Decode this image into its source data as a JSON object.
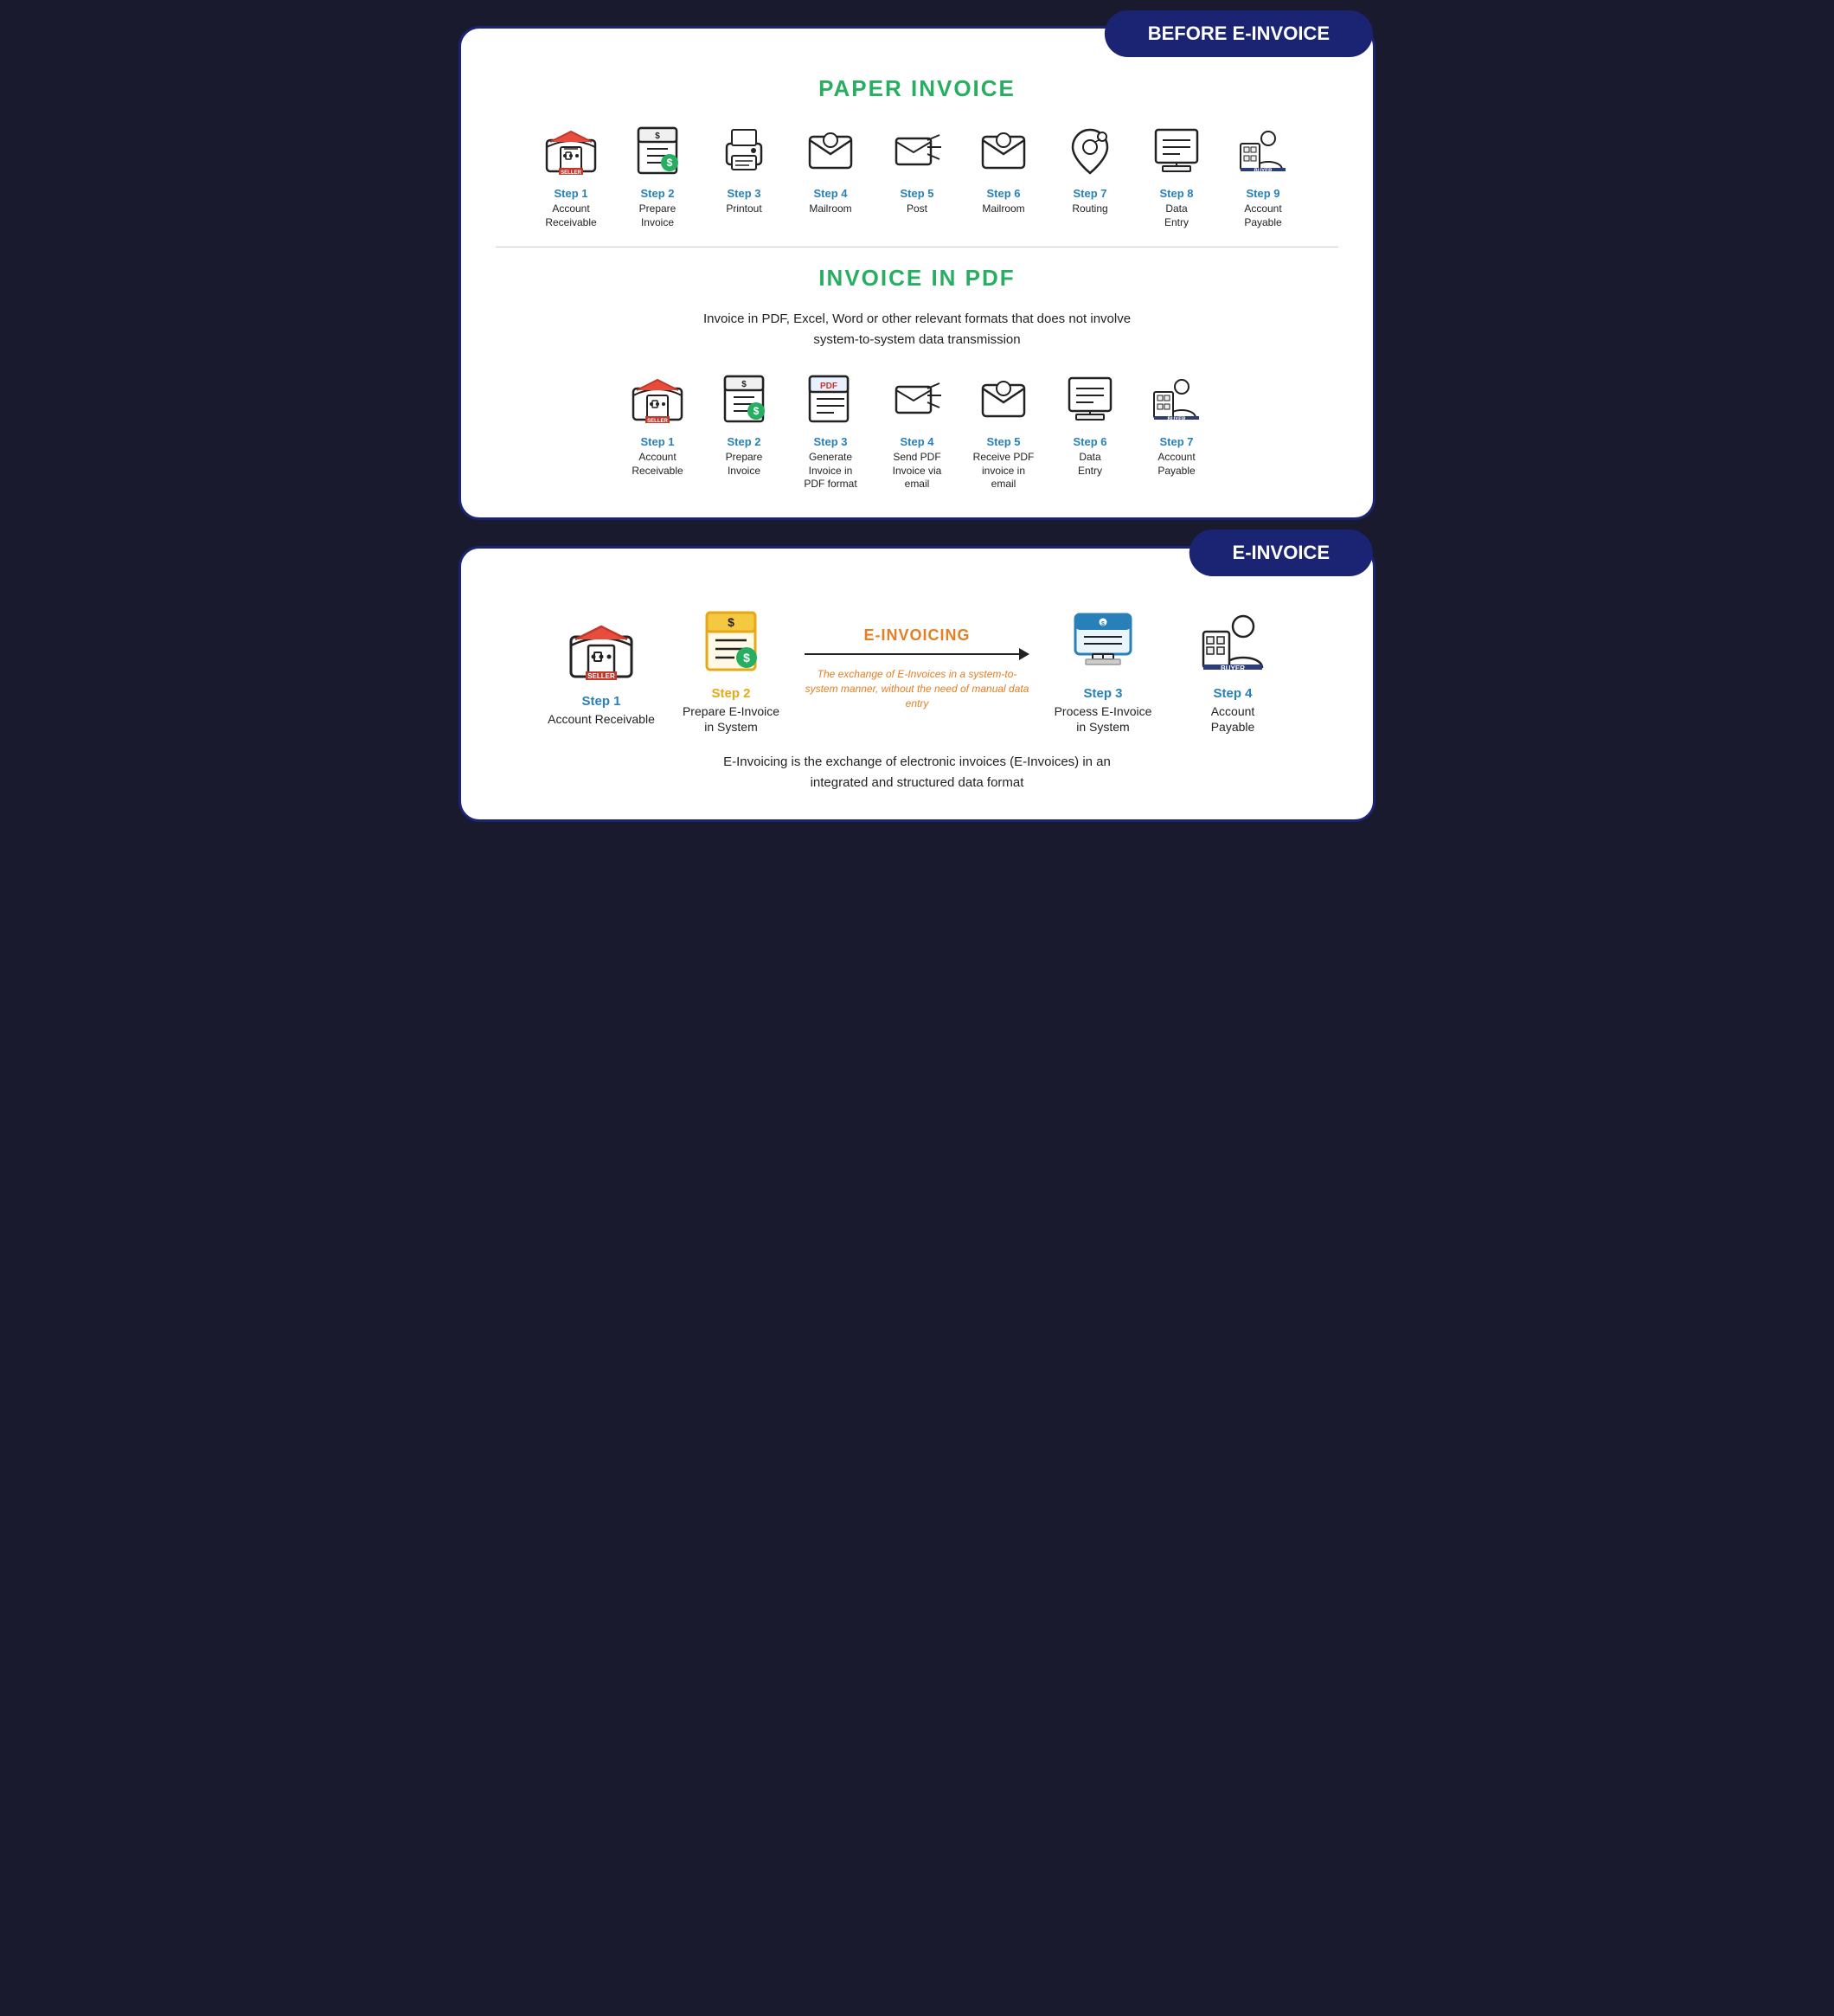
{
  "before_badge": "BEFORE E-INVOICE",
  "einvoice_badge": "E-INVOICE",
  "paper_invoice": {
    "title": "PAPER INVOICE",
    "steps": [
      {
        "label": "Step 1",
        "desc": "Account\nReceivable",
        "icon": "seller",
        "badge": "SELLER"
      },
      {
        "label": "Step 2",
        "desc": "Prepare\nInvoice",
        "icon": "invoice"
      },
      {
        "label": "Step 3",
        "desc": "Printout",
        "icon": "printer"
      },
      {
        "label": "Step 4",
        "desc": "Mailroom",
        "icon": "mailroom"
      },
      {
        "label": "Step 5",
        "desc": "Post",
        "icon": "post"
      },
      {
        "label": "Step 6",
        "desc": "Mailroom",
        "icon": "mailroom"
      },
      {
        "label": "Step 7",
        "desc": "Routing",
        "icon": "routing"
      },
      {
        "label": "Step 8",
        "desc": "Data\nEntry",
        "icon": "dataentry"
      },
      {
        "label": "Step 9",
        "desc": "Account\nPayable",
        "icon": "buyer",
        "badge": "BUYER"
      }
    ]
  },
  "pdf_invoice": {
    "title": "INVOICE IN PDF",
    "description": "Invoice in PDF, Excel, Word or other relevant formats that does not involve\nsystem-to-system data transmission",
    "steps": [
      {
        "label": "Step 1",
        "desc": "Account\nReceivable",
        "icon": "seller",
        "badge": "SELLER"
      },
      {
        "label": "Step 2",
        "desc": "Prepare\nInvoice",
        "icon": "invoice"
      },
      {
        "label": "Step 3",
        "desc": "Generate\nInvoice in\nPDF format",
        "icon": "pdf"
      },
      {
        "label": "Step 4",
        "desc": "Send PDF\nInvoice via\nemail",
        "icon": "post"
      },
      {
        "label": "Step 5",
        "desc": "Receive PDF\ninvoice in\nemail",
        "icon": "mailroom"
      },
      {
        "label": "Step 6",
        "desc": "Data\nEntry",
        "icon": "dataentry"
      },
      {
        "label": "Step 7",
        "desc": "Account\nPayable",
        "icon": "buyer",
        "badge": "BUYER"
      }
    ]
  },
  "einvoice": {
    "steps": [
      {
        "label": "Step 1",
        "desc": "Account Receivable",
        "icon": "seller",
        "badge": "SELLER"
      },
      {
        "label": "Step 2",
        "desc": "Prepare E-Invoice\nin System",
        "icon": "einvoice_doc"
      },
      {
        "label": "Step 3",
        "desc": "Process E-Invoice\nin System",
        "icon": "monitor"
      },
      {
        "label": "Step 4",
        "desc": "Account\nPayable",
        "icon": "buyer",
        "badge": "BUYER"
      }
    ],
    "middle_label": "E-INVOICING",
    "middle_desc": "The exchange of E-Invoices in a system-to-system manner, without the need of manual data entry",
    "footer": "E-Invoicing is the exchange of electronic invoices (E-Invoices) in an\nintegrated and structured data format"
  }
}
